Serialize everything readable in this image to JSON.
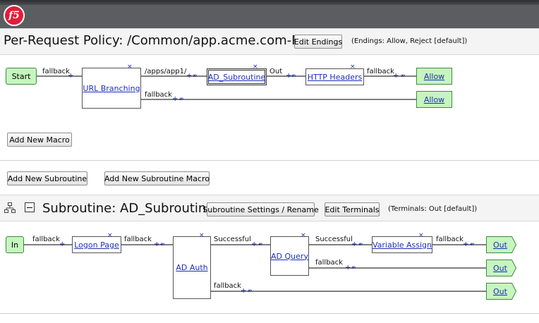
{
  "logo": {
    "text": "f5"
  },
  "policy": {
    "title": "Per-Request Policy: /Common/app.acme.com-PRP",
    "edit_endings": "Edit Endings",
    "endings_note": "(Endings: Allow, Reject [default])",
    "add_macro": "Add New Macro",
    "add_subroutine": "Add New Subroutine",
    "add_subroutine_macro": "Add New Subroutine Macro",
    "flow": {
      "start": "Start",
      "start_branch": "fallback",
      "url_branching": "URL Branching",
      "branch_app": "/apps/app1/",
      "branch_fallback": "fallback",
      "ad_subroutine": "AD_Subroutine",
      "out_label": "Out",
      "http_headers": "HTTP Headers",
      "http_branch": "fallback",
      "allow_1": "Allow",
      "allow_2": "Allow"
    }
  },
  "subroutine": {
    "title": "Subroutine: AD_Subroutine",
    "settings_btn": "Subroutine Settings / Rename",
    "edit_terminals": "Edit Terminals",
    "terminals_note": "(Terminals: Out [default])",
    "flow": {
      "in": "In",
      "in_branch": "fallback",
      "logon_page": "Logon Page",
      "logon_branch": "fallback",
      "ad_auth": "AD Auth",
      "auth_success": "Successful",
      "auth_fallback": "fallback",
      "ad_query": "AD Query",
      "query_success": "Successful",
      "query_fallback": "fallback",
      "variable_assign": "Variable Assign",
      "assign_branch": "fallback",
      "out_1": "Out",
      "out_2": "Out",
      "out_3": "Out"
    }
  },
  "colors": {
    "banner": "#5b5d61",
    "logo": "#e21d38",
    "terminal_fill": "#c6f5bf",
    "link": "#1d2fb8"
  }
}
